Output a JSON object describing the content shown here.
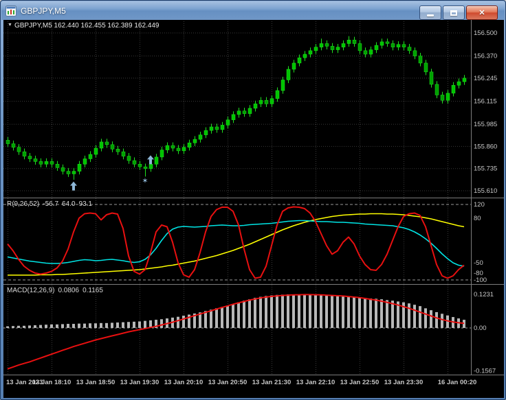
{
  "window": {
    "title": "GBPJPY,M5"
  },
  "icons": {
    "dropdown": "▼",
    "close": "✕",
    "star": "✶"
  },
  "chart": {
    "symbol_info_text": "GBPJPY,M5 162.440 162.455 162.389 162.449",
    "price_axis_labels": [
      "156.500",
      "156.370",
      "156.245",
      "156.115",
      "155.985",
      "155.860",
      "155.735",
      "155.610"
    ],
    "time_axis_labels": [
      "13 Jan 2023",
      "13 Jan 18:10",
      "13 Jan 18:50",
      "13 Jan 19:30",
      "13 Jan 20:10",
      "13 Jan 20:50",
      "13 Jan 21:30",
      "13 Jan 22:10",
      "13 Jan 22:50",
      "13 Jan 23:30",
      "16 Jan 00:20"
    ]
  },
  "indicators": {
    "r": {
      "name": "R(9,26,52)",
      "values": [
        "-56.7",
        "64.0",
        "93.1"
      ],
      "axis_labels": [
        "120",
        "80",
        "-50",
        "-80",
        "-100"
      ]
    },
    "macd": {
      "name": "MACD(12,26,9)",
      "values": [
        "0.0806",
        "0.1165"
      ],
      "axis_labels": [
        "0.1231",
        "0.00",
        "-0.1567"
      ]
    }
  },
  "colors": {
    "bg": "#000000",
    "grid": "#3a3a3a",
    "separator": "#7d7d7d",
    "axis_text": "#c8c8c8",
    "bull": "#00c400",
    "bear": "#00a000",
    "candle_stroke": "#1fe01f",
    "r_fast": "#e81010",
    "r_mid": "#00e5e5",
    "r_slow": "#ffff00",
    "macd_hist": "#b8b8b8",
    "macd_signal": "#e81010",
    "marker": "#8fb8d8",
    "level_dash": "#9a9a9a"
  },
  "chart_data": [
    {
      "type": "candlestick",
      "symbol": "GBPJPY",
      "timeframe": "M5",
      "ylim": [
        155.56,
        156.56
      ],
      "x_tick_indices": [
        0,
        8,
        16,
        24,
        32,
        40,
        48,
        56,
        64,
        72,
        80
      ],
      "x_tick_labels": [
        "13 Jan 2023",
        "13 Jan 18:10",
        "13 Jan 18:50",
        "13 Jan 19:30",
        "13 Jan 20:10",
        "13 Jan 20:50",
        "13 Jan 21:30",
        "13 Jan 22:10",
        "13 Jan 22:50",
        "13 Jan 23:30",
        "16 Jan 00:20"
      ],
      "first_open": 155.895,
      "wick": 0.018,
      "closes": [
        155.875,
        155.855,
        155.83,
        155.805,
        155.79,
        155.775,
        155.76,
        155.775,
        155.76,
        155.74,
        155.72,
        155.705,
        155.72,
        155.76,
        155.79,
        155.815,
        155.85,
        155.885,
        155.87,
        155.845,
        155.83,
        155.805,
        155.78,
        155.76,
        155.745,
        155.735,
        155.76,
        155.8,
        155.84,
        155.865,
        155.85,
        155.835,
        155.855,
        155.88,
        155.9,
        155.925,
        155.95,
        155.97,
        155.955,
        155.98,
        156.01,
        156.04,
        156.06,
        156.045,
        156.075,
        156.1,
        156.12,
        156.1,
        156.13,
        156.175,
        156.235,
        156.295,
        156.33,
        156.36,
        156.38,
        156.4,
        156.42,
        156.44,
        156.425,
        156.405,
        156.42,
        156.44,
        156.46,
        156.44,
        156.4,
        156.38,
        156.405,
        156.43,
        156.45,
        156.44,
        156.42,
        156.435,
        156.42,
        156.4,
        156.37,
        156.33,
        156.28,
        156.21,
        156.15,
        156.12,
        156.16,
        156.205,
        156.225,
        156.245
      ],
      "low_overrides": {
        "11": 155.688,
        "12": 155.672,
        "25": 155.69
      },
      "high_overrides": {
        "57": 156.468,
        "62": 156.482
      },
      "markers": [
        {
          "type": "arrow-up",
          "index": 12,
          "price": 155.662
        },
        {
          "type": "arrow-up",
          "index": 26,
          "price": 155.81
        },
        {
          "type": "star",
          "index": 25,
          "price": 155.668
        }
      ]
    },
    {
      "type": "line",
      "title": "R(9,26,52)",
      "ylim": [
        -112,
        134
      ],
      "levels": [
        120,
        -100
      ],
      "current_values": [
        -56.7,
        64.0,
        93.1
      ],
      "series": [
        {
          "name": "slow",
          "color_key": "r_slow",
          "values": [
            -86,
            -86,
            -86,
            -86,
            -86,
            -86,
            -85,
            -85,
            -85,
            -84,
            -84,
            -83,
            -82,
            -81,
            -80,
            -79,
            -78,
            -77,
            -76,
            -75,
            -74,
            -73,
            -72,
            -71,
            -70,
            -68,
            -66,
            -64,
            -62,
            -59,
            -57,
            -54,
            -51,
            -48,
            -45,
            -41,
            -37,
            -33,
            -29,
            -24,
            -19,
            -14,
            -8,
            -2,
            4,
            11,
            18,
            25,
            32,
            39,
            46,
            52,
            58,
            63,
            68,
            72,
            76,
            79,
            82,
            85,
            87,
            89,
            90,
            91,
            92,
            92,
            93,
            93,
            93,
            92,
            92,
            91,
            90,
            88,
            86,
            84,
            81,
            78,
            74,
            70,
            66,
            62,
            58,
            55
          ]
        },
        {
          "name": "mid",
          "color_key": "r_mid",
          "values": [
            -33,
            -36,
            -39,
            -42,
            -45,
            -47,
            -49,
            -51,
            -52,
            -52,
            -51,
            -49,
            -46,
            -43,
            -41,
            -42,
            -44,
            -43,
            -41,
            -40,
            -42,
            -44,
            -47,
            -49,
            -47,
            -40,
            -27,
            -8,
            15,
            35,
            48,
            54,
            56,
            55,
            54,
            55,
            56,
            58,
            59,
            60,
            59,
            58,
            58,
            59,
            61,
            62,
            63,
            64,
            65,
            67,
            69,
            71,
            72,
            73,
            73,
            72,
            71,
            70,
            70,
            69,
            68,
            68,
            67,
            66,
            65,
            63,
            62,
            61,
            60,
            59,
            58,
            55,
            52,
            47,
            40,
            31,
            20,
            7,
            -8,
            -24,
            -38,
            -50,
            -57,
            -60
          ]
        },
        {
          "name": "fast",
          "color_key": "r_fast",
          "values": [
            5,
            -15,
            -40,
            -60,
            -72,
            -80,
            -83,
            -80,
            -75,
            -65,
            -45,
            -10,
            40,
            80,
            93,
            95,
            93,
            75,
            90,
            95,
            92,
            50,
            -30,
            -75,
            -83,
            -70,
            -20,
            40,
            60,
            55,
            10,
            -50,
            -85,
            -92,
            -70,
            -20,
            40,
            85,
            105,
            112,
            112,
            100,
            60,
            -10,
            -70,
            -95,
            -92,
            -60,
            0,
            60,
            100,
            110,
            113,
            112,
            108,
            95,
            70,
            35,
            0,
            -25,
            -15,
            10,
            25,
            5,
            -30,
            -55,
            -70,
            -72,
            -55,
            -25,
            15,
            55,
            85,
            93,
            95,
            88,
            55,
            0,
            -55,
            -88,
            -95,
            -88,
            -70,
            -57
          ]
        }
      ]
    },
    {
      "type": "bar+line",
      "title": "MACD(12,26,9)",
      "ylim": [
        -0.1709,
        0.1558
      ],
      "zero_level": 0.0,
      "current_values": [
        0.0806,
        0.1165
      ],
      "series": [
        {
          "name": "macd_histogram",
          "color_key": "macd_hist",
          "values": [
            0.006,
            0.007,
            0.008,
            0.008,
            0.009,
            0.01,
            0.011,
            0.012,
            0.013,
            0.013,
            0.014,
            0.015,
            0.015,
            0.016,
            0.016,
            0.017,
            0.017,
            0.018,
            0.018,
            0.019,
            0.02,
            0.021,
            0.022,
            0.023,
            0.024,
            0.026,
            0.028,
            0.03,
            0.032,
            0.035,
            0.038,
            0.041,
            0.045,
            0.049,
            0.053,
            0.057,
            0.062,
            0.067,
            0.072,
            0.077,
            0.082,
            0.088,
            0.094,
            0.1,
            0.105,
            0.11,
            0.114,
            0.117,
            0.119,
            0.121,
            0.122,
            0.123,
            0.1231,
            0.123,
            0.122,
            0.1215,
            0.121,
            0.12,
            0.119,
            0.118,
            0.116,
            0.115,
            0.113,
            0.112,
            0.111,
            0.11,
            0.108,
            0.107,
            0.105,
            0.102,
            0.1,
            0.097,
            0.094,
            0.09,
            0.085,
            0.08,
            0.072,
            0.065,
            0.058,
            0.052,
            0.046,
            0.04,
            0.035,
            0.03
          ]
        },
        {
          "name": "signal",
          "color_key": "macd_signal",
          "values": [
            -0.15,
            -0.143,
            -0.136,
            -0.13,
            -0.124,
            -0.117,
            -0.11,
            -0.103,
            -0.096,
            -0.089,
            -0.082,
            -0.075,
            -0.068,
            -0.062,
            -0.056,
            -0.05,
            -0.044,
            -0.039,
            -0.034,
            -0.029,
            -0.024,
            -0.019,
            -0.014,
            -0.01,
            -0.006,
            -0.002,
            0.002,
            0.006,
            0.011,
            0.016,
            0.021,
            0.027,
            0.033,
            0.039,
            0.045,
            0.051,
            0.057,
            0.063,
            0.069,
            0.075,
            0.081,
            0.087,
            0.092,
            0.097,
            0.102,
            0.106,
            0.11,
            0.113,
            0.1155,
            0.1175,
            0.119,
            0.12,
            0.121,
            0.1215,
            0.122,
            0.122,
            0.1215,
            0.121,
            0.12,
            0.119,
            0.118,
            0.117,
            0.115,
            0.113,
            0.111,
            0.108,
            0.105,
            0.102,
            0.098,
            0.094,
            0.089,
            0.084,
            0.078,
            0.072,
            0.065,
            0.058,
            0.051,
            0.044,
            0.037,
            0.031,
            0.026,
            0.022,
            0.019,
            0.017
          ]
        }
      ]
    }
  ]
}
